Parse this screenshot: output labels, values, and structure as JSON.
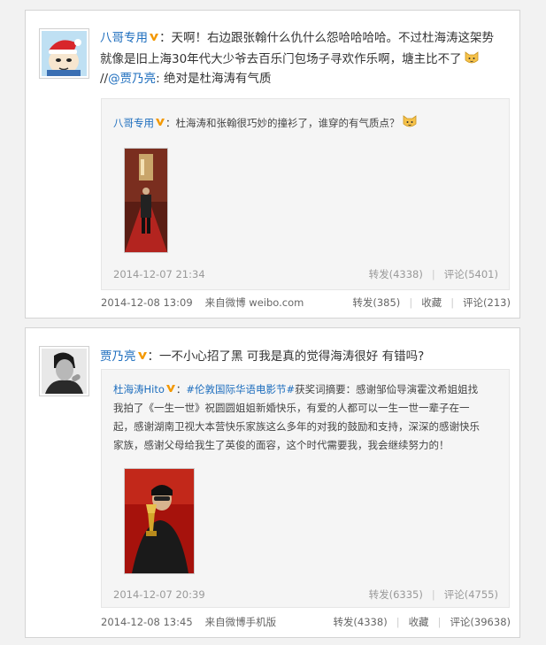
{
  "posts": [
    {
      "author": "八哥专用",
      "avatar_icon": "santa-hat-cartoon-avatar",
      "text_line1": "：天啊！右边跟张翰什么仇什么怨哈哈哈哈。不过杜海涛这架势",
      "text_line2": "就像是旧上海30年代大少爷去百乐门包场子寻欢作乐啊，塘主比不了",
      "repost_prefix": "//",
      "repost_user": "@贾乃亮",
      "repost_text": ": 绝对是杜海涛有气质",
      "quote": {
        "author": "八哥专用",
        "text": "：杜海涛和张翰很巧妙的撞衫了，谁穿的有气质点？",
        "image_icon": "photo-man-in-red-hallway",
        "time": "2014-12-07 21:34",
        "repost": "转发(4338)",
        "comment": "评论(5401)"
      },
      "footer": {
        "time": "2014-12-08 13:09",
        "source": "来自微博 weibo.com",
        "repost": "转发(385)",
        "favorite": "收藏",
        "comment": "评论(213)"
      }
    },
    {
      "author": "贾乃亮",
      "avatar_icon": "bw-portrait-avatar",
      "text": "：一不小心招了黑 可我是真的觉得海涛很好 有错吗?",
      "quote": {
        "author": "杜海涛Hito",
        "hashtag": "#伦敦国际华语电影节#",
        "line1": "获奖词摘要：感谢邹佡导演霍汶希姐姐找",
        "line2": "我拍了《一生一世》祝圆圆姐姐新婚快乐，有爱的人都可以一生一世一辈子在一",
        "line3": "起，感谢湖南卫视大本营快乐家族这么多年的对我的鼓励和支持，深深的感谢快乐",
        "line4": "家族，感谢父母给我生了英俊的面容，这个时代需要我，我会继续努力的！",
        "image_icon": "photo-man-holding-trophy",
        "time": "2014-12-07 20:39",
        "repost": "转发(6335)",
        "comment": "评论(4755)"
      },
      "footer": {
        "time": "2014-12-08 13:45",
        "source": "来自微博手机版",
        "repost": "转发(4338)",
        "favorite": "收藏",
        "comment": "评论(39638)"
      }
    }
  ],
  "colors": {
    "link": "#1e6ebe",
    "v_badge": "#f39800",
    "meta": "#999999"
  }
}
